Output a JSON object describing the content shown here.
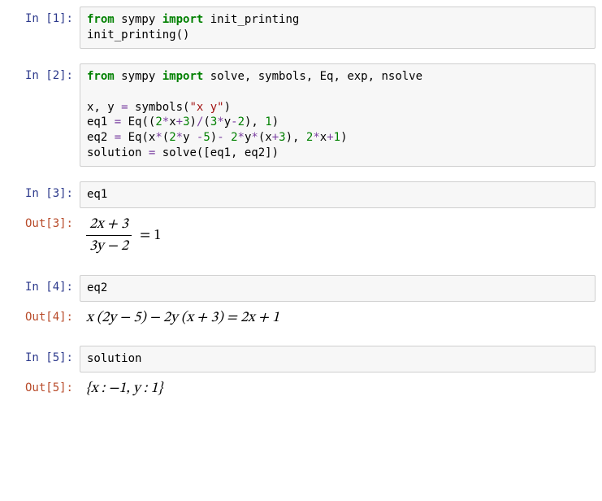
{
  "cells": {
    "in1_prompt": "In [1]:",
    "in1_line1_pre": "",
    "in1_line1_kw1": "from",
    "in1_line1_mid1": " sympy ",
    "in1_line1_kw2": "import",
    "in1_line1_post": " init_printing",
    "in1_line2": "init_printing()",
    "in2_prompt": "In [2]:",
    "in2_l1_kw1": "from",
    "in2_l1_mid1": " sympy ",
    "in2_l1_kw2": "import",
    "in2_l1_post": " solve, symbols, Eq, exp, nsolve",
    "in2_blank": "",
    "in2_l3_a": "x, y ",
    "in2_l3_op": "=",
    "in2_l3_b": " symbols(",
    "in2_l3_str": "\"x y\"",
    "in2_l3_c": ")",
    "in2_l4_a": "eq1 ",
    "in2_l4_op1": "=",
    "in2_l4_b": " Eq((",
    "in2_l4_n1": "2",
    "in2_l4_op2": "*",
    "in2_l4_c": "x",
    "in2_l4_op3": "+",
    "in2_l4_n2": "3",
    "in2_l4_d": ")",
    "in2_l4_op4": "/",
    "in2_l4_e": "(",
    "in2_l4_n3": "3",
    "in2_l4_op5": "*",
    "in2_l4_f": "y",
    "in2_l4_op6": "-",
    "in2_l4_n4": "2",
    "in2_l4_g": "), ",
    "in2_l4_n5": "1",
    "in2_l4_h": ")",
    "in2_l5_a": "eq2 ",
    "in2_l5_op1": "=",
    "in2_l5_b": " Eq(x",
    "in2_l5_op2": "*",
    "in2_l5_c": "(",
    "in2_l5_n1": "2",
    "in2_l5_op3": "*",
    "in2_l5_d": "y ",
    "in2_l5_op4": "-",
    "in2_l5_n2": "5",
    "in2_l5_e": ")",
    "in2_l5_op5": "-",
    "in2_l5_f": " ",
    "in2_l5_n3": "2",
    "in2_l5_op6": "*",
    "in2_l5_g": "y",
    "in2_l5_op7": "*",
    "in2_l5_h": "(x",
    "in2_l5_op8": "+",
    "in2_l5_n4": "3",
    "in2_l5_i": "), ",
    "in2_l5_n5": "2",
    "in2_l5_op9": "*",
    "in2_l5_j": "x",
    "in2_l5_op10": "+",
    "in2_l5_n6": "1",
    "in2_l5_k": ")",
    "in2_l6_a": "solution ",
    "in2_l6_op": "=",
    "in2_l6_b": " solve([eq1, eq2])",
    "in3_prompt": "In [3]:",
    "in3_code": "eq1",
    "out3_prompt": "Out[3]:",
    "out3_frac_top": "2x + 3",
    "out3_frac_bot": "3y − 2",
    "out3_rhs": " = 1",
    "in4_prompt": "In [4]:",
    "in4_code": "eq2",
    "out4_prompt": "Out[4]:",
    "out4_math": "x (2y − 5) − 2y (x + 3) = 2x + 1",
    "in5_prompt": "In [5]:",
    "in5_code": "solution",
    "out5_prompt": "Out[5]:",
    "out5_math": "{x : −1,  y : 1}"
  }
}
